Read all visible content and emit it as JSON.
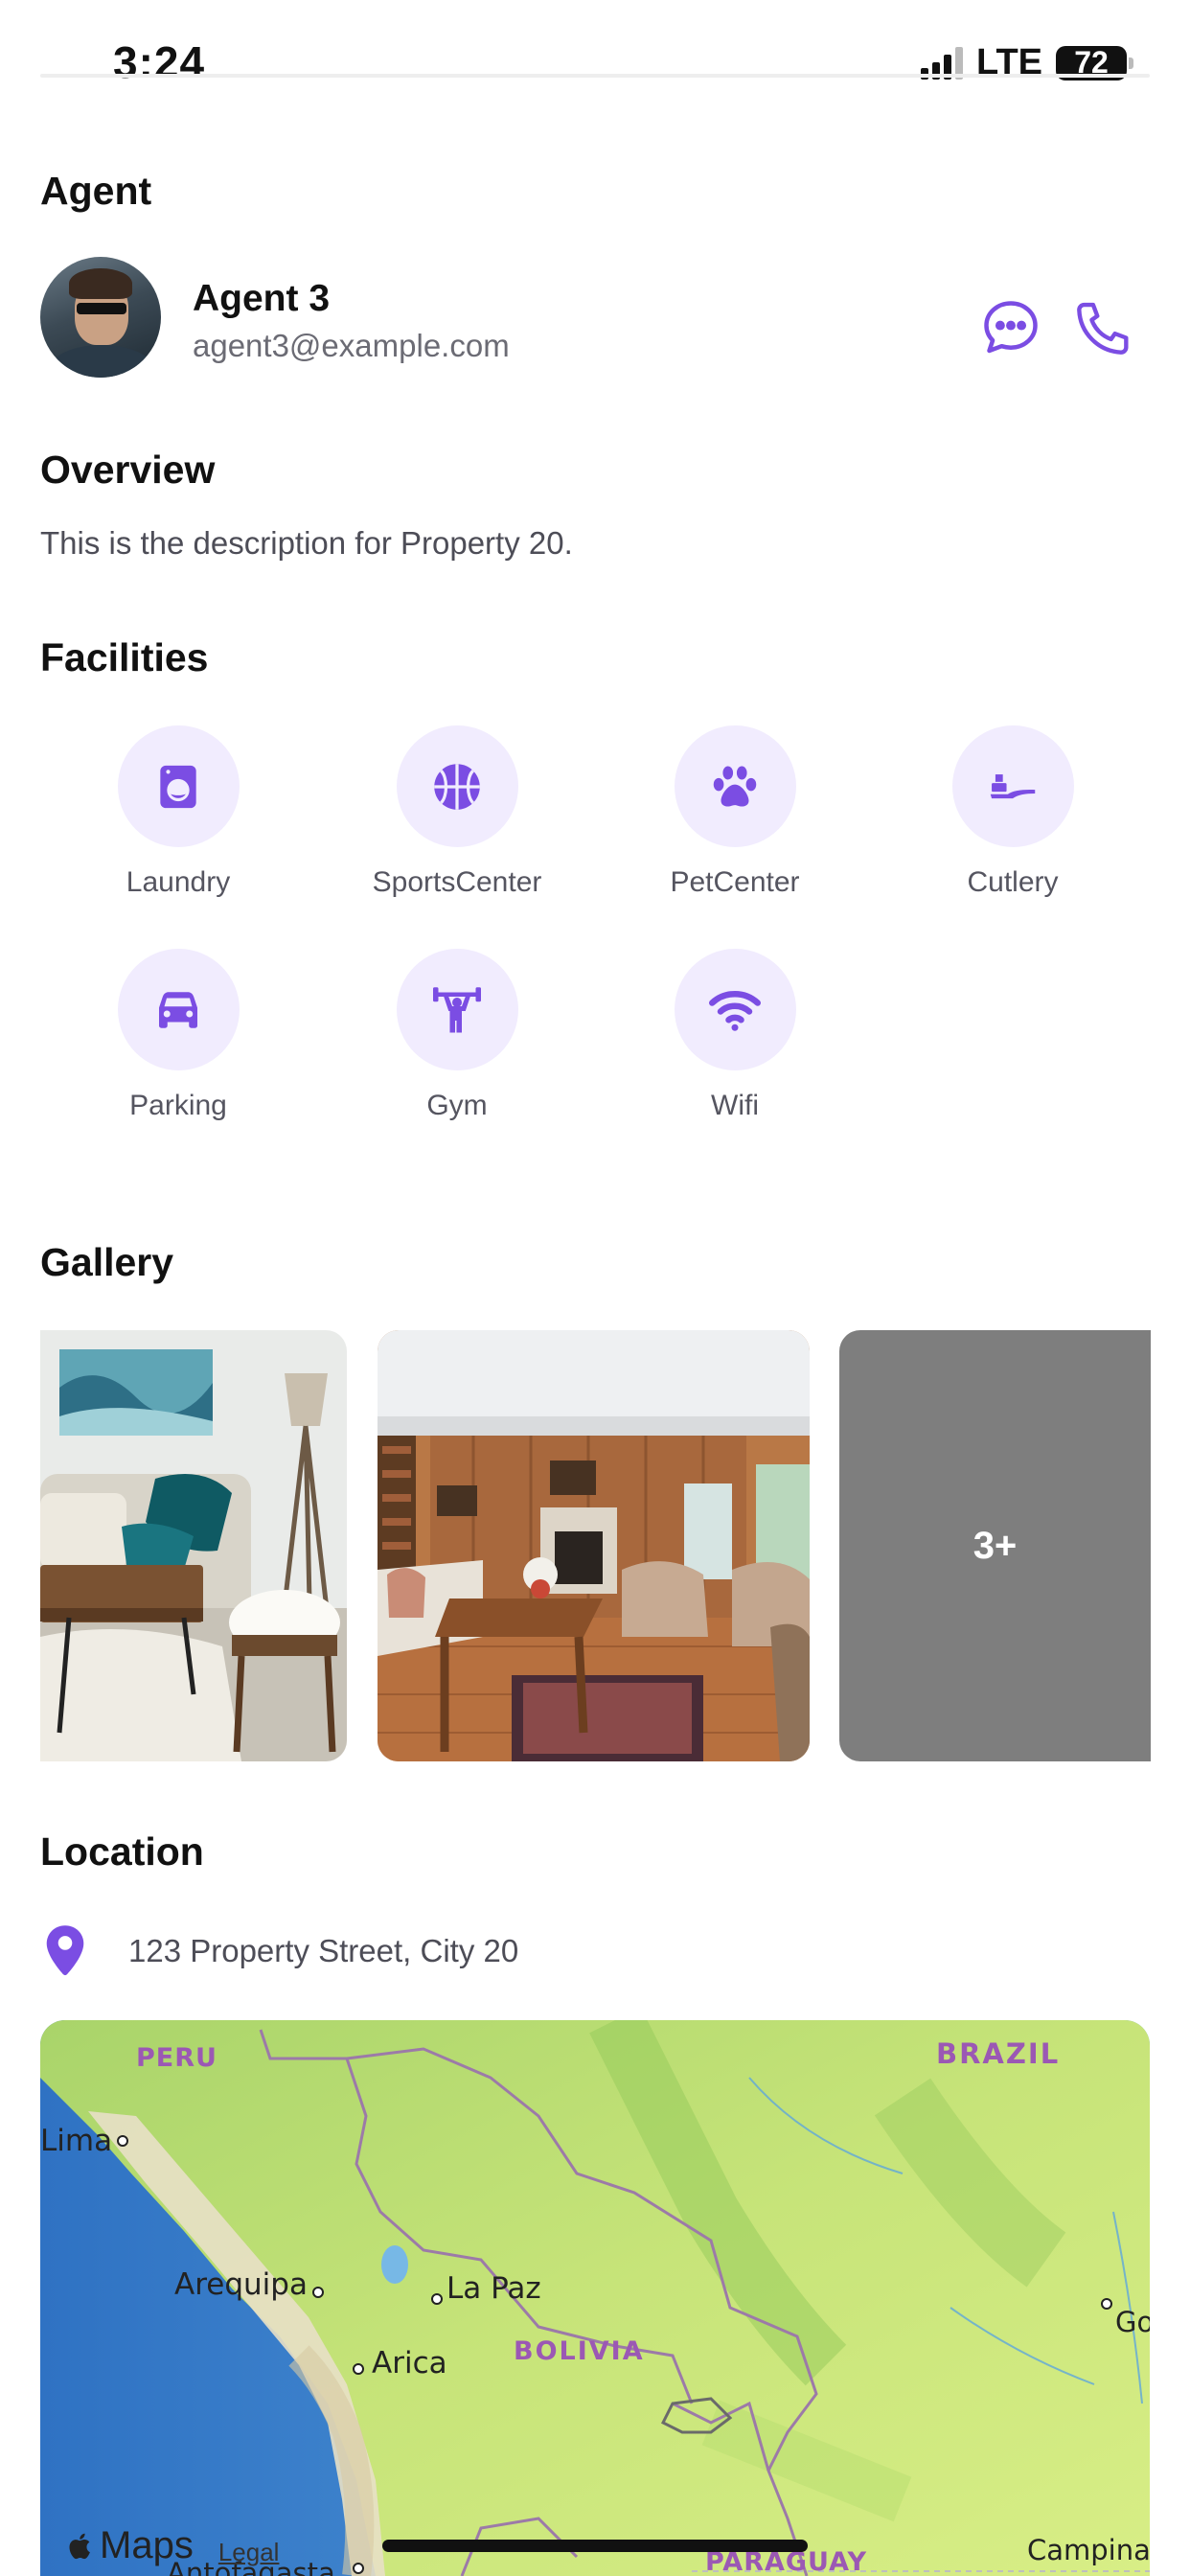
{
  "status_bar": {
    "time": "3:24",
    "network": "LTE",
    "battery": "72"
  },
  "agent_section": {
    "title": "Agent",
    "name": "Agent 3",
    "email": "agent3@example.com",
    "message_icon": "chat-bubble-icon",
    "call_icon": "phone-icon"
  },
  "overview": {
    "title": "Overview",
    "description": "This is the description for Property 20."
  },
  "facilities": {
    "title": "Facilities",
    "items": [
      {
        "label": "Laundry",
        "icon": "washing-machine-icon"
      },
      {
        "label": "SportsCenter",
        "icon": "basketball-icon"
      },
      {
        "label": "PetCenter",
        "icon": "paw-icon"
      },
      {
        "label": "Cutlery",
        "icon": "cutlery-icon"
      },
      {
        "label": "Parking",
        "icon": "car-icon"
      },
      {
        "label": "Gym",
        "icon": "weightlifter-icon"
      },
      {
        "label": "Wifi",
        "icon": "wifi-icon"
      }
    ]
  },
  "gallery": {
    "title": "Gallery",
    "more_label": "3+"
  },
  "location": {
    "title": "Location",
    "address": "123 Property Street, City 20",
    "map": {
      "labels": {
        "peru": "PERU",
        "brazil": "BRAZIL",
        "lima": "Lima",
        "arequipa": "Arequipa",
        "la_paz": "La Paz",
        "arica": "Arica",
        "bolivia": "BOLIVIA",
        "paraguay": "PARAGUAY",
        "campinas": "Campina",
        "go": "Go",
        "antofagasta": "Antofagasta"
      },
      "maps_brand": "Maps",
      "legal": "Legal"
    }
  },
  "colors": {
    "accent": "#7b4de3",
    "accent_light": "#f1ecfe",
    "text_secondary": "#6b6b74"
  }
}
